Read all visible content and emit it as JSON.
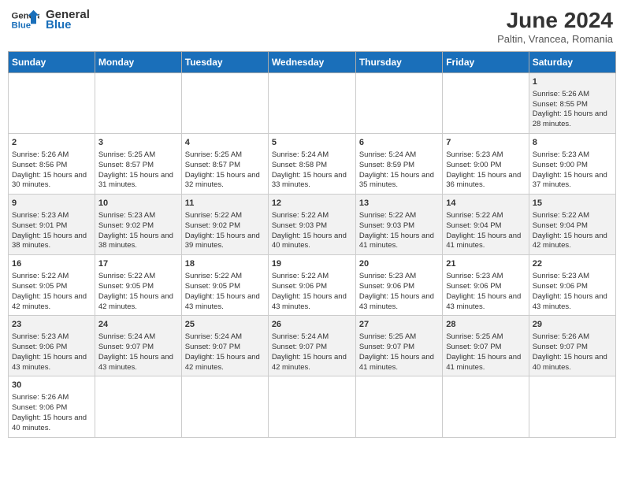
{
  "header": {
    "logo_general": "General",
    "logo_blue": "Blue",
    "month_title": "June 2024",
    "subtitle": "Paltin, Vrancea, Romania"
  },
  "days_of_week": [
    "Sunday",
    "Monday",
    "Tuesday",
    "Wednesday",
    "Thursday",
    "Friday",
    "Saturday"
  ],
  "weeks": [
    {
      "cells": [
        {
          "day": "",
          "info": ""
        },
        {
          "day": "",
          "info": ""
        },
        {
          "day": "",
          "info": ""
        },
        {
          "day": "",
          "info": ""
        },
        {
          "day": "",
          "info": ""
        },
        {
          "day": "",
          "info": ""
        },
        {
          "day": "1",
          "info": "Sunrise: 5:26 AM\nSunset: 8:55 PM\nDaylight: 15 hours and 28 minutes."
        }
      ]
    },
    {
      "cells": [
        {
          "day": "2",
          "info": "Sunrise: 5:26 AM\nSunset: 8:56 PM\nDaylight: 15 hours and 30 minutes."
        },
        {
          "day": "3",
          "info": "Sunrise: 5:25 AM\nSunset: 8:57 PM\nDaylight: 15 hours and 31 minutes."
        },
        {
          "day": "4",
          "info": "Sunrise: 5:25 AM\nSunset: 8:57 PM\nDaylight: 15 hours and 32 minutes."
        },
        {
          "day": "5",
          "info": "Sunrise: 5:24 AM\nSunset: 8:58 PM\nDaylight: 15 hours and 33 minutes."
        },
        {
          "day": "6",
          "info": "Sunrise: 5:24 AM\nSunset: 8:59 PM\nDaylight: 15 hours and 35 minutes."
        },
        {
          "day": "7",
          "info": "Sunrise: 5:23 AM\nSunset: 9:00 PM\nDaylight: 15 hours and 36 minutes."
        },
        {
          "day": "8",
          "info": "Sunrise: 5:23 AM\nSunset: 9:00 PM\nDaylight: 15 hours and 37 minutes."
        }
      ]
    },
    {
      "cells": [
        {
          "day": "9",
          "info": "Sunrise: 5:23 AM\nSunset: 9:01 PM\nDaylight: 15 hours and 38 minutes."
        },
        {
          "day": "10",
          "info": "Sunrise: 5:23 AM\nSunset: 9:02 PM\nDaylight: 15 hours and 38 minutes."
        },
        {
          "day": "11",
          "info": "Sunrise: 5:22 AM\nSunset: 9:02 PM\nDaylight: 15 hours and 39 minutes."
        },
        {
          "day": "12",
          "info": "Sunrise: 5:22 AM\nSunset: 9:03 PM\nDaylight: 15 hours and 40 minutes."
        },
        {
          "day": "13",
          "info": "Sunrise: 5:22 AM\nSunset: 9:03 PM\nDaylight: 15 hours and 41 minutes."
        },
        {
          "day": "14",
          "info": "Sunrise: 5:22 AM\nSunset: 9:04 PM\nDaylight: 15 hours and 41 minutes."
        },
        {
          "day": "15",
          "info": "Sunrise: 5:22 AM\nSunset: 9:04 PM\nDaylight: 15 hours and 42 minutes."
        }
      ]
    },
    {
      "cells": [
        {
          "day": "16",
          "info": "Sunrise: 5:22 AM\nSunset: 9:05 PM\nDaylight: 15 hours and 42 minutes."
        },
        {
          "day": "17",
          "info": "Sunrise: 5:22 AM\nSunset: 9:05 PM\nDaylight: 15 hours and 42 minutes."
        },
        {
          "day": "18",
          "info": "Sunrise: 5:22 AM\nSunset: 9:05 PM\nDaylight: 15 hours and 43 minutes."
        },
        {
          "day": "19",
          "info": "Sunrise: 5:22 AM\nSunset: 9:06 PM\nDaylight: 15 hours and 43 minutes."
        },
        {
          "day": "20",
          "info": "Sunrise: 5:23 AM\nSunset: 9:06 PM\nDaylight: 15 hours and 43 minutes."
        },
        {
          "day": "21",
          "info": "Sunrise: 5:23 AM\nSunset: 9:06 PM\nDaylight: 15 hours and 43 minutes."
        },
        {
          "day": "22",
          "info": "Sunrise: 5:23 AM\nSunset: 9:06 PM\nDaylight: 15 hours and 43 minutes."
        }
      ]
    },
    {
      "cells": [
        {
          "day": "23",
          "info": "Sunrise: 5:23 AM\nSunset: 9:06 PM\nDaylight: 15 hours and 43 minutes."
        },
        {
          "day": "24",
          "info": "Sunrise: 5:24 AM\nSunset: 9:07 PM\nDaylight: 15 hours and 43 minutes."
        },
        {
          "day": "25",
          "info": "Sunrise: 5:24 AM\nSunset: 9:07 PM\nDaylight: 15 hours and 42 minutes."
        },
        {
          "day": "26",
          "info": "Sunrise: 5:24 AM\nSunset: 9:07 PM\nDaylight: 15 hours and 42 minutes."
        },
        {
          "day": "27",
          "info": "Sunrise: 5:25 AM\nSunset: 9:07 PM\nDaylight: 15 hours and 41 minutes."
        },
        {
          "day": "28",
          "info": "Sunrise: 5:25 AM\nSunset: 9:07 PM\nDaylight: 15 hours and 41 minutes."
        },
        {
          "day": "29",
          "info": "Sunrise: 5:26 AM\nSunset: 9:07 PM\nDaylight: 15 hours and 40 minutes."
        }
      ]
    },
    {
      "cells": [
        {
          "day": "30",
          "info": "Sunrise: 5:26 AM\nSunset: 9:06 PM\nDaylight: 15 hours and 40 minutes."
        },
        {
          "day": "",
          "info": ""
        },
        {
          "day": "",
          "info": ""
        },
        {
          "day": "",
          "info": ""
        },
        {
          "day": "",
          "info": ""
        },
        {
          "day": "",
          "info": ""
        },
        {
          "day": "",
          "info": ""
        }
      ]
    }
  ]
}
